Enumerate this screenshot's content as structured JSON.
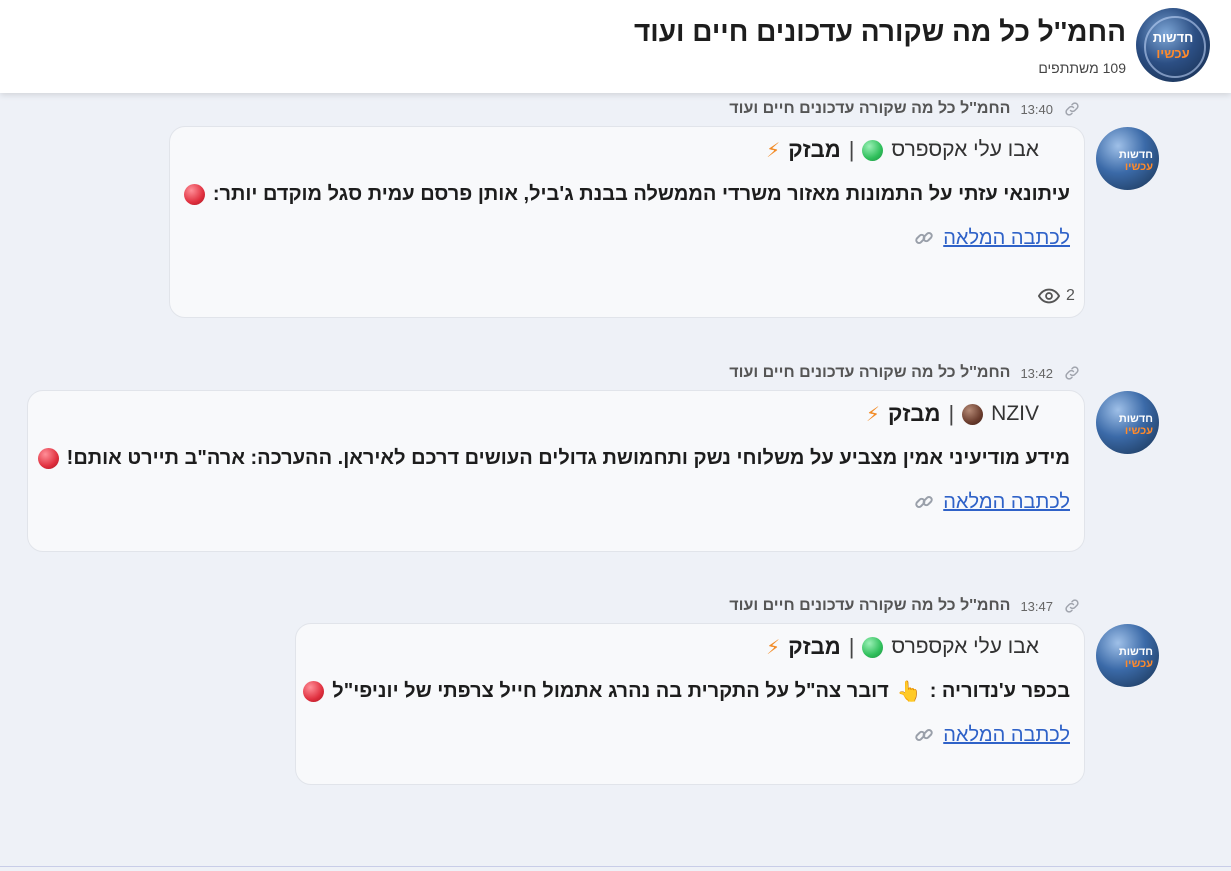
{
  "header": {
    "title": "החמ''ל כל מה שקורה עדכונים חיים ועוד",
    "subscribers": "109 משתתפים",
    "avatar_text_line1": "חדשות",
    "avatar_text_line2": "עכשיו"
  },
  "messages": [
    {
      "author": "החמ''ל כל מה שקורה עדכונים חיים ועוד",
      "time": "13:40",
      "source_name": "מבזק",
      "separator": "|",
      "source_author": "אבו עלי אקספרס",
      "source_dot_color": "green",
      "text": "עיתונאי עזתי על התמונות מאזור משרדי הממשלה בבנת ג'ביל, אותן פרסם עמית סגל מוקדם יותר:",
      "read_more": "לכתבה המלאה",
      "views": "2"
    },
    {
      "author": "החמ''ל כל מה שקורה עדכונים חיים ועוד",
      "time": "13:42",
      "source_name": "מבזק",
      "separator": "|",
      "source_author": "NZIV",
      "source_dot_color": "brown",
      "text": "מידע מודיעיני אמין מצביע על משלוחי נשק ותחמושת גדולים העושים דרכם לאיראן. ההערכה: ארה\"ב תיירט אותם!",
      "read_more": "לכתבה המלאה"
    },
    {
      "author": "החמ''ל כל מה שקורה עדכונים חיים ועוד",
      "time": "13:47",
      "source_name": "מבזק",
      "separator": "|",
      "source_author": "אבו עלי אקספרס",
      "source_dot_color": "green",
      "text_before": "דובר צה\"ל על התקרית בה נהרג אתמול חייל צרפתי של יוניפי\"ל",
      "emoji": "👆",
      "text_after": "בכפר ע'נדוריה :",
      "read_more": "לכתבה המלאה"
    }
  ],
  "icons": {
    "bolt": "⚡",
    "bolt_color": "#f28c28",
    "link_color": "#2f62c8"
  }
}
